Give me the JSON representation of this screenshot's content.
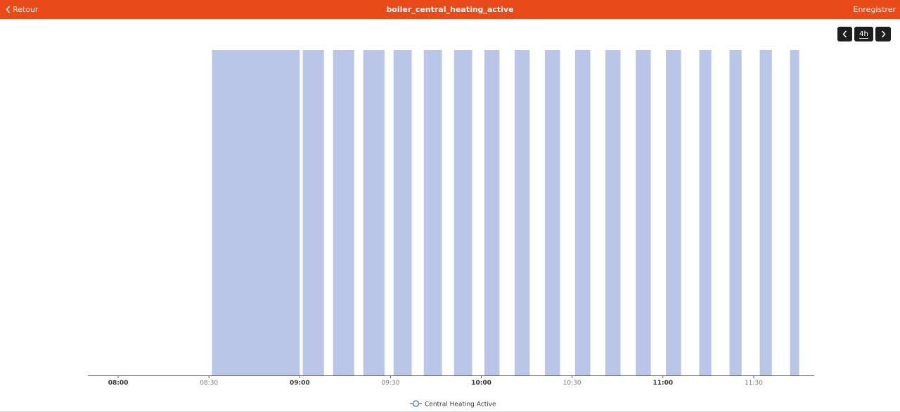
{
  "header": {
    "back_label": "Retour",
    "title": "boiler_central_heating_active",
    "save_label": "Enregistrer",
    "background_color": "#e84a1a"
  },
  "controls": {
    "range_label": "4h",
    "prev_icon": "chevron-left-icon",
    "next_icon": "chevron-right-icon"
  },
  "chart_data": {
    "type": "area",
    "title": "",
    "xlabel": "",
    "ylabel": "",
    "x_tick_labels": [
      "08:00",
      "08:30",
      "09:00",
      "09:30",
      "10:00",
      "10:30",
      "11:00",
      "11:30"
    ],
    "x_tick_bold": [
      true,
      false,
      true,
      false,
      true,
      false,
      true,
      false
    ],
    "xlim": [
      "07:50",
      "11:50"
    ],
    "ylim": [
      0,
      1
    ],
    "grid": false,
    "legend": "bottom-center",
    "series": [
      {
        "name": "Central Heating Active",
        "color": "#b9c6e8",
        "line_color": "#6a82c8",
        "active_intervals": [
          [
            "08:31",
            "09:00"
          ],
          [
            "09:01",
            "09:08"
          ],
          [
            "09:11",
            "09:18"
          ],
          [
            "09:21",
            "09:28"
          ],
          [
            "09:31",
            "09:37"
          ],
          [
            "09:41",
            "09:47"
          ],
          [
            "09:51",
            "09:57"
          ],
          [
            "10:01",
            "10:06"
          ],
          [
            "10:11",
            "10:16"
          ],
          [
            "10:21",
            "10:26"
          ],
          [
            "10:31",
            "10:36"
          ],
          [
            "10:41",
            "10:46"
          ],
          [
            "10:51",
            "10:56"
          ],
          [
            "11:01",
            "11:06"
          ],
          [
            "11:12",
            "11:16"
          ],
          [
            "11:22",
            "11:26"
          ],
          [
            "11:32",
            "11:36"
          ],
          [
            "11:42",
            "11:45"
          ]
        ]
      }
    ]
  }
}
